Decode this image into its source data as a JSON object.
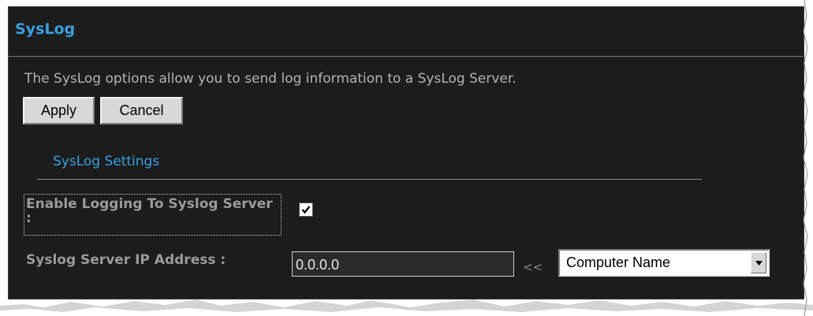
{
  "section": {
    "title": "SysLog"
  },
  "description": "The SysLog options allow you to send log information to a SysLog Server.",
  "buttons": {
    "apply": "Apply",
    "cancel": "Cancel"
  },
  "settings": {
    "heading": "SysLog Settings",
    "enable_label": "Enable Logging To Syslog Server :",
    "enable_checked": true,
    "ip_label": "Syslog Server IP Address :",
    "ip_value": "0.0.0.0",
    "copy_arrows": "<<",
    "computer_select_value": "Computer Name"
  },
  "colors": {
    "panel_background": "#1c1c1c",
    "accent_blue": "#3aa0e0",
    "label_gray": "#9a9a9a"
  },
  "icons": {
    "checkbox": "checkmark-icon",
    "select_arrow": "triangle-down-icon"
  }
}
